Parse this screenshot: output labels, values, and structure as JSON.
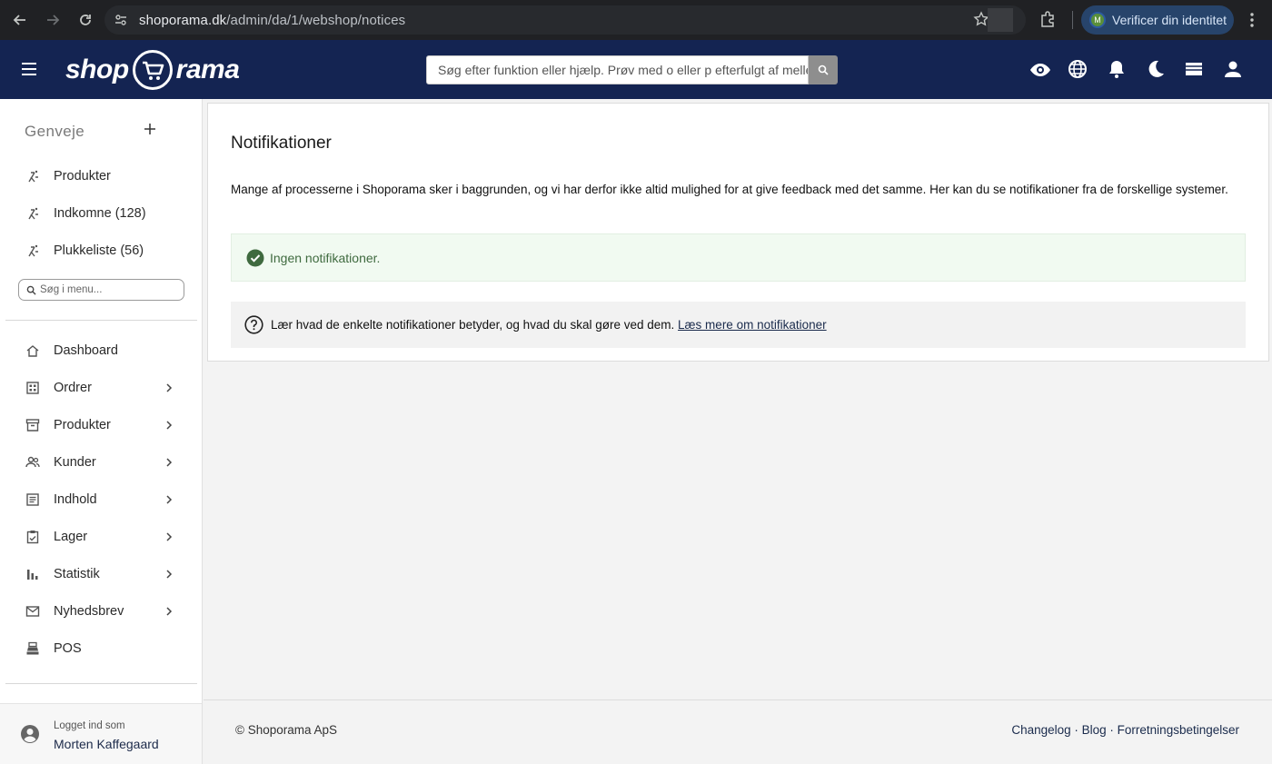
{
  "browser": {
    "url_host": "shoporama.dk",
    "url_path": "/admin/da/1/webshop/notices",
    "verify_label": "Verificer din identitet",
    "avatar_letter": "M"
  },
  "header": {
    "logo_left": "shop",
    "logo_right": "rama",
    "search_placeholder": "Søg efter funktion eller hjælp. Prøv med o eller p efterfulgt af mellemrum",
    "icons": [
      "eye-icon",
      "globe-icon",
      "bell-icon",
      "moon-icon",
      "card-icon",
      "user-icon"
    ]
  },
  "sidebar": {
    "shortcuts_title": "Genveje",
    "shortcuts": [
      {
        "label": "Produkter"
      },
      {
        "label": "Indkomne (128)"
      },
      {
        "label": "Plukkeliste (56)"
      }
    ],
    "menu_search_placeholder": "Søg i menu...",
    "menu": [
      {
        "label": "Dashboard",
        "icon": "home-icon",
        "chevron": false
      },
      {
        "label": "Ordrer",
        "icon": "grid-icon",
        "chevron": true
      },
      {
        "label": "Produkter",
        "icon": "archive-icon",
        "chevron": true
      },
      {
        "label": "Kunder",
        "icon": "people-icon",
        "chevron": true
      },
      {
        "label": "Indhold",
        "icon": "document-icon",
        "chevron": true
      },
      {
        "label": "Lager",
        "icon": "clipboard-icon",
        "chevron": true
      },
      {
        "label": "Statistik",
        "icon": "bar-chart-icon",
        "chevron": true
      },
      {
        "label": "Nyhedsbrev",
        "icon": "mail-icon",
        "chevron": true
      },
      {
        "label": "POS",
        "icon": "register-icon",
        "chevron": false
      }
    ],
    "logged_in_label": "Logget ind som",
    "user_name": "Morten Kaffegaard"
  },
  "main": {
    "title": "Notifikationer",
    "description": "Mange af processerne i Shoporama sker i baggrunden, og vi har derfor ikke altid mulighed for at give feedback med det samme. Her kan du se notifikationer fra de forskellige systemer.",
    "success_text": "Ingen notifikationer.",
    "info_text": "Lær hvad de enkelte notifikationer betyder, og hvad du skal gøre ved dem.",
    "info_link": "Læs mere om notifikationer"
  },
  "footer": {
    "copyright": "© Shoporama ApS",
    "links": [
      "Changelog",
      "Blog",
      "Forretningsbetingelser"
    ]
  },
  "colors": {
    "header_bg": "#142452",
    "success_bg": "#f1faf1",
    "success_icon": "#3f6a3f",
    "verify_bg": "#27446b"
  }
}
